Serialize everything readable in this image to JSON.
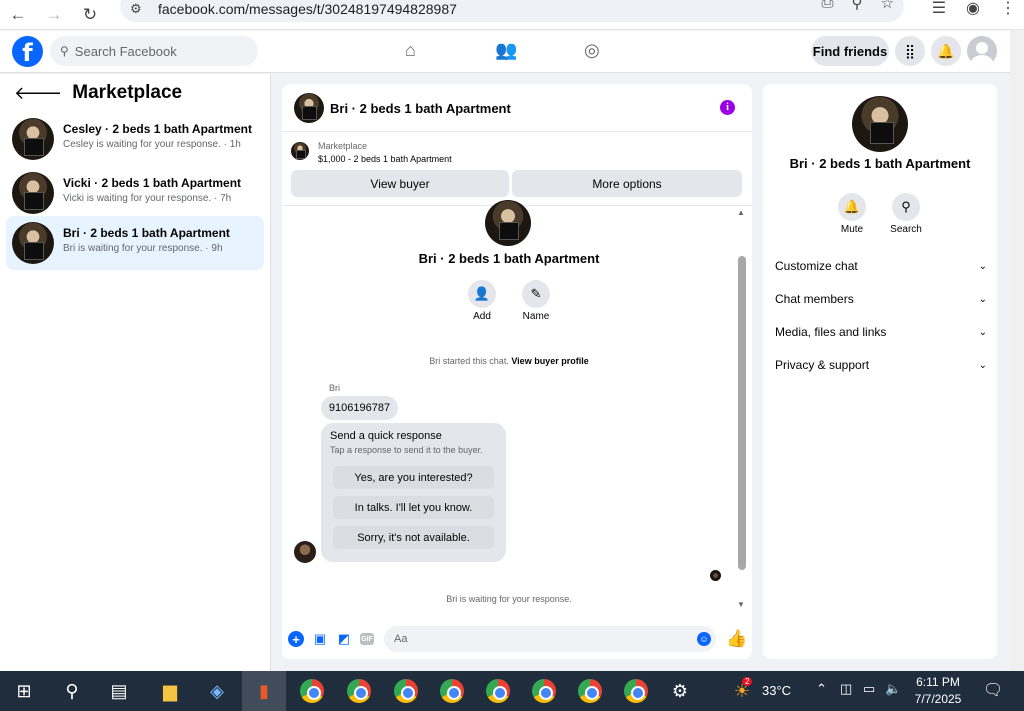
{
  "browser": {
    "url": "facebook.com/messages/t/30248197494828987"
  },
  "fbnav": {
    "logo": "f",
    "search_placeholder": "Search Facebook",
    "find_friends": "Find friends"
  },
  "left_panel": {
    "title": "Marketplace",
    "conversations": [
      {
        "name": "Cesley · 2 beds 1 bath Apartment",
        "status": "Cesley is waiting for your response. · 1h"
      },
      {
        "name": "Vicki · 2 beds 1 bath Apartment",
        "status": "Vicki is waiting for your response. · 7h"
      },
      {
        "name": "Bri · 2 beds 1 bath Apartment",
        "status": "Bri is waiting for your response. · 9h"
      }
    ]
  },
  "chat": {
    "title": "Bri · 2 beds 1 bath Apartment",
    "marketplace_label": "Marketplace",
    "listing": "$1,000 - 2 beds 1 bath Apartment",
    "view_buyer": "View buyer",
    "more_options": "More options",
    "center_name": "Bri · 2 beds 1 bath Apartment",
    "add_label": "Add",
    "name_label": "Name",
    "started_text": "Bri started this chat.",
    "view_profile": "View buyer profile",
    "sender": "Bri",
    "phone_message": "9106196787",
    "quick_title": "Send a quick response",
    "quick_sub": "Tap a response to send it to the buyer.",
    "quick_responses": [
      "Yes, are you interested?",
      "In talks. I'll let you know.",
      "Sorry, it's not available."
    ],
    "waiting": "Bri is waiting for your response.",
    "composer_placeholder": "Aa"
  },
  "right_panel": {
    "name": "Bri · 2 beds 1 bath Apartment",
    "mute": "Mute",
    "search": "Search",
    "sections": [
      "Customize chat",
      "Chat members",
      "Media, files and links",
      "Privacy & support"
    ]
  },
  "taskbar": {
    "weather_temp": "33°C",
    "time": "6:11 PM",
    "date": "7/7/2025",
    "chrome_badge": "2"
  }
}
